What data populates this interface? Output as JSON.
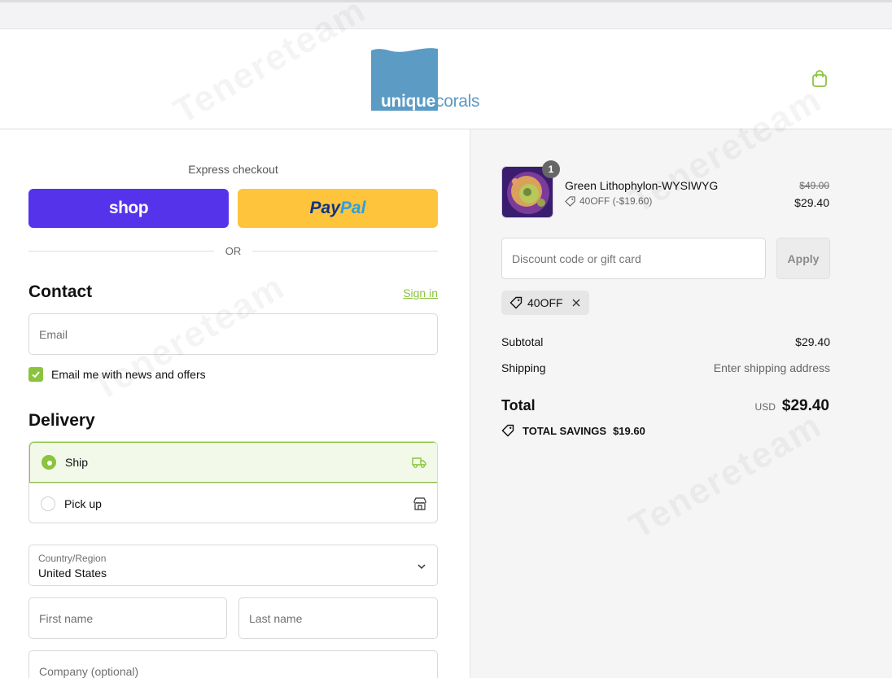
{
  "brand": {
    "logo_part1": "unique",
    "logo_part2": "corals",
    "color": "#5b9bc4"
  },
  "accent": "#8ac43f",
  "express": {
    "label": "Express checkout",
    "shop_label": "shop",
    "paypal_part1": "Pay",
    "paypal_part2": "Pal",
    "divider": "OR"
  },
  "contact": {
    "heading": "Contact",
    "signin": "Sign in",
    "email_placeholder": "Email",
    "newsletter_label": "Email me with news and offers",
    "newsletter_checked": true
  },
  "delivery": {
    "heading": "Delivery",
    "options": [
      {
        "label": "Ship",
        "selected": true,
        "icon": "truck-icon"
      },
      {
        "label": "Pick up",
        "selected": false,
        "icon": "store-icon"
      }
    ],
    "country_caption": "Country/Region",
    "country_value": "United States",
    "first_name_placeholder": "First name",
    "last_name_placeholder": "Last name",
    "company_placeholder": "Company (optional)"
  },
  "summary": {
    "item": {
      "name": "Green Lithophylon-WYSIWYG",
      "quantity": "1",
      "discount": "40OFF (-$19.60)",
      "original_price": "$49.00",
      "price": "$29.40"
    },
    "discount_placeholder": "Discount code or gift card",
    "apply_label": "Apply",
    "applied_code": "40OFF",
    "subtotal_label": "Subtotal",
    "subtotal_value": "$29.40",
    "shipping_label": "Shipping",
    "shipping_value": "Enter shipping address",
    "total_label": "Total",
    "currency": "USD",
    "total_value": "$29.40",
    "savings_label": "TOTAL SAVINGS",
    "savings_value": "$19.60"
  },
  "watermark": "Tenereteam"
}
